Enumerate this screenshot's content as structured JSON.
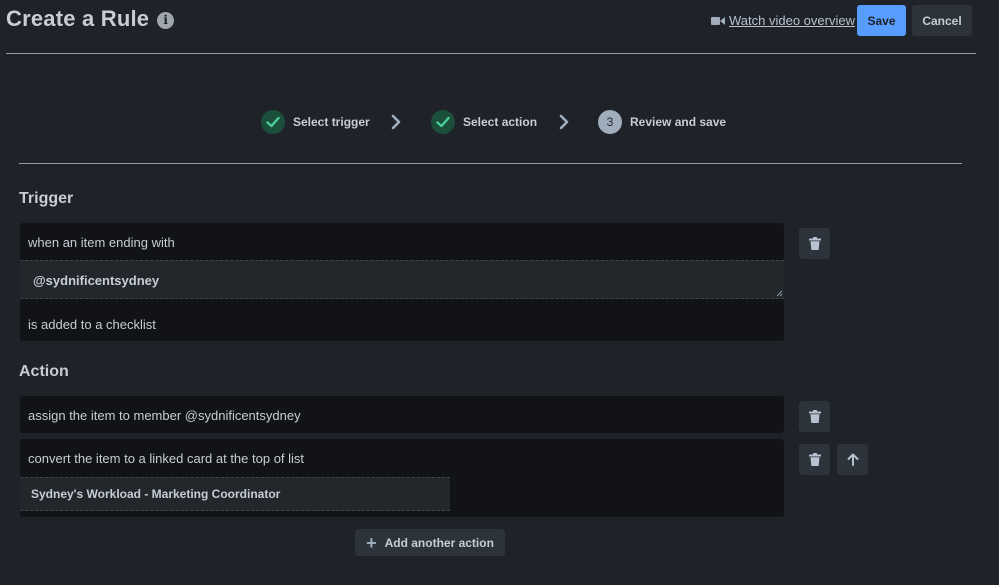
{
  "header": {
    "title": "Create a Rule",
    "info_glyph": "i",
    "video_link": "Watch video overview",
    "save_label": "Save",
    "cancel_label": "Cancel"
  },
  "stepper": {
    "steps": [
      {
        "label": "Select trigger",
        "state": "done"
      },
      {
        "label": "Select action",
        "state": "done"
      },
      {
        "label": "Review and save",
        "state": "current",
        "number": "3"
      }
    ]
  },
  "trigger": {
    "heading": "Trigger",
    "line1": "when an item ending with",
    "value": "@sydnificentsydney",
    "line2": "is added to a checklist"
  },
  "action": {
    "heading": "Action",
    "items": [
      {
        "text": "assign the item to member @sydnificentsydney"
      },
      {
        "text": "convert the item to a linked card at the top of list",
        "value": "Sydney's Workload - Marketing Coordinator"
      }
    ],
    "add_label": "Add another action"
  },
  "colors": {
    "background": "#1f2228",
    "save_button": "#579dff",
    "step_done": "#1c4f3b",
    "step_check": "#4bce97"
  },
  "icons": {
    "info": "info-icon",
    "video": "video-camera-icon",
    "check": "check-icon",
    "chevron": "chevron-right-icon",
    "trash": "trash-icon",
    "arrow_up": "arrow-up-icon",
    "plus": "plus-icon"
  }
}
